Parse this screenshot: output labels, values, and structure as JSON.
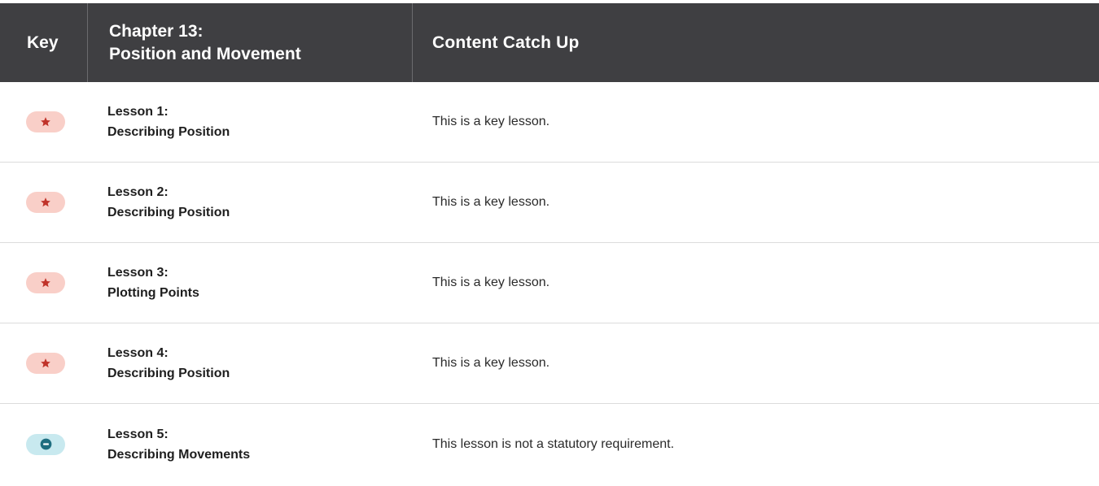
{
  "header": {
    "key_label": "Key",
    "chapter_line1": "Chapter 13:",
    "chapter_line2": "Position and Movement",
    "content_label": "Content Catch Up"
  },
  "colors": {
    "header_bg": "#3f3f42",
    "key_badge_bg": "#f9cfc8",
    "key_icon": "#c0332a",
    "optional_badge_bg": "#c8e9ef",
    "optional_icon": "#1f6e80"
  },
  "rows": [
    {
      "icon": "star-icon",
      "lesson_line1": "Lesson 1:",
      "lesson_line2": "Describing Position",
      "description": "This is a key lesson."
    },
    {
      "icon": "star-icon",
      "lesson_line1": "Lesson 2:",
      "lesson_line2": "Describing Position",
      "description": "This is a key lesson."
    },
    {
      "icon": "star-icon",
      "lesson_line1": "Lesson 3:",
      "lesson_line2": "Plotting Points",
      "description": "This is a key lesson."
    },
    {
      "icon": "star-icon",
      "lesson_line1": "Lesson 4:",
      "lesson_line2": "Describing Position",
      "description": "This is a key lesson."
    },
    {
      "icon": "minus-circle-icon",
      "lesson_line1": "Lesson 5:",
      "lesson_line2": "Describing Movements",
      "description": "This lesson is not a statutory requirement."
    }
  ]
}
